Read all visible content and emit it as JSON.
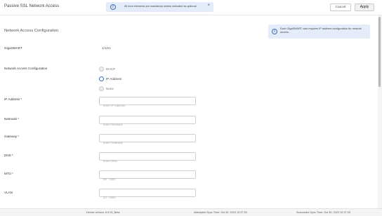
{
  "header": {
    "title": "Passive SSL Network Access",
    "banner_text": "All form elements are mandatory unless indicated as optional.",
    "close_glyph": "×",
    "cancel_label": "Cancel",
    "apply_label": "Apply"
  },
  "section": {
    "title": "Network Access Configuration",
    "note": "Each GigaSMART card requires IP address configuration for network access."
  },
  "form": {
    "gigasmart": {
      "label": "GigaSMART",
      "value": "1/1/e1"
    },
    "network_access": {
      "label": "Network Access Configuration",
      "options": [
        "DHCP",
        "IP Address",
        "None"
      ],
      "selected": "IP Address"
    },
    "ip_address": {
      "label": "IP Address",
      "required": "*",
      "placeholder": "Enter IP Address"
    },
    "netmask": {
      "label": "Netmask",
      "required": "*",
      "placeholder": "Enter Netmask"
    },
    "gateway": {
      "label": "Gateway",
      "required": "*",
      "placeholder": "Enter Gateway"
    },
    "dns": {
      "label": "DNS",
      "required": "*",
      "placeholder": "Enter DNS"
    },
    "mtu": {
      "label": "MTU",
      "required": "*",
      "placeholder": "68 - 1500"
    },
    "vlan": {
      "label": "VLAN",
      "placeholder": "20 - 4094"
    }
  },
  "footer": {
    "device_version": "Device version: 6.5.00_Beta",
    "attempted_sync": "Attempted Sync Time: Oct 30, 2023 12:37:33",
    "successful_sync": "Successful Sync Time: Oct 30, 2023 12:37:33"
  },
  "icons": {
    "info": "info-circle-icon",
    "close": "close-icon"
  },
  "colors": {
    "accent": "#3d6db5",
    "banner_bg": "#e3ecf8"
  }
}
